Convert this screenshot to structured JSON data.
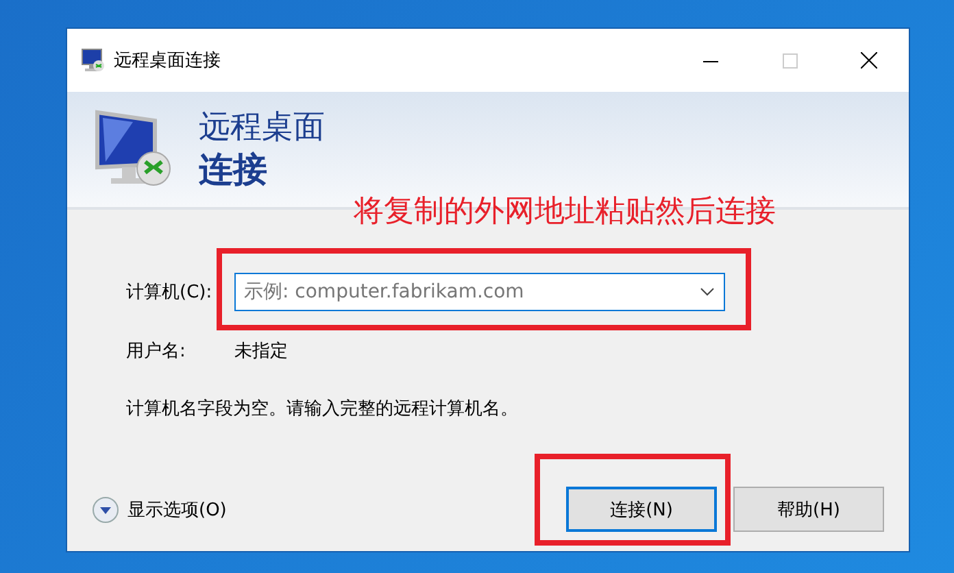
{
  "window": {
    "title": "远程桌面连接",
    "maximize_disabled": true
  },
  "banner": {
    "line1": "远程桌面",
    "line2": "连接"
  },
  "computer": {
    "label": "计算机(C):",
    "placeholder": "示例: computer.fabrikam.com"
  },
  "username": {
    "label": "用户名:",
    "value": "未指定"
  },
  "message": "计算机名字段为空。请输入完整的远程计算机名。",
  "options": {
    "label": "显示选项(O)"
  },
  "buttons": [
    {
      "label": "连接(N)",
      "selected": true
    },
    {
      "label": "帮助(H)",
      "selected": false
    }
  ],
  "annotation": {
    "note": "将复制的外网地址粘贴然后连接"
  }
}
